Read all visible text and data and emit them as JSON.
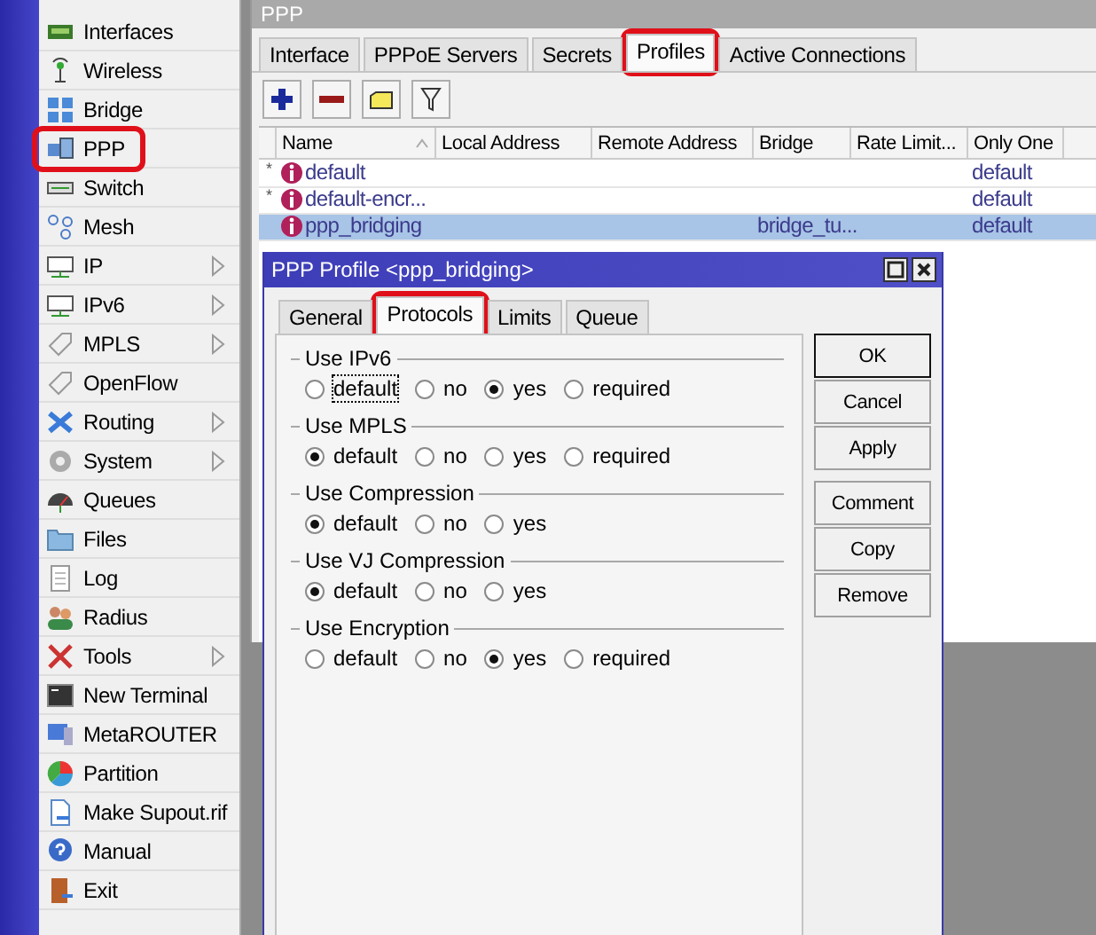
{
  "sidebar": {
    "items": [
      {
        "label": "Interfaces",
        "submenu": false,
        "highlighted": false
      },
      {
        "label": "Wireless",
        "submenu": false,
        "highlighted": false
      },
      {
        "label": "Bridge",
        "submenu": false,
        "highlighted": false
      },
      {
        "label": "PPP",
        "submenu": false,
        "highlighted": true
      },
      {
        "label": "Switch",
        "submenu": false,
        "highlighted": false
      },
      {
        "label": "Mesh",
        "submenu": false,
        "highlighted": false
      },
      {
        "label": "IP",
        "submenu": true,
        "highlighted": false
      },
      {
        "label": "IPv6",
        "submenu": true,
        "highlighted": false
      },
      {
        "label": "MPLS",
        "submenu": true,
        "highlighted": false
      },
      {
        "label": "OpenFlow",
        "submenu": false,
        "highlighted": false
      },
      {
        "label": "Routing",
        "submenu": true,
        "highlighted": false
      },
      {
        "label": "System",
        "submenu": true,
        "highlighted": false
      },
      {
        "label": "Queues",
        "submenu": false,
        "highlighted": false
      },
      {
        "label": "Files",
        "submenu": false,
        "highlighted": false
      },
      {
        "label": "Log",
        "submenu": false,
        "highlighted": false
      },
      {
        "label": "Radius",
        "submenu": false,
        "highlighted": false
      },
      {
        "label": "Tools",
        "submenu": true,
        "highlighted": false
      },
      {
        "label": "New Terminal",
        "submenu": false,
        "highlighted": false
      },
      {
        "label": "MetaROUTER",
        "submenu": false,
        "highlighted": false
      },
      {
        "label": "Partition",
        "submenu": false,
        "highlighted": false
      },
      {
        "label": "Make Supout.rif",
        "submenu": false,
        "highlighted": false
      },
      {
        "label": "Manual",
        "submenu": false,
        "highlighted": false
      },
      {
        "label": "Exit",
        "submenu": false,
        "highlighted": false
      }
    ]
  },
  "window": {
    "title": "PPP",
    "tabs": [
      {
        "label": "Interface",
        "selected": false,
        "highlighted": false
      },
      {
        "label": "PPPoE Servers",
        "selected": false,
        "highlighted": false
      },
      {
        "label": "Secrets",
        "selected": false,
        "highlighted": false
      },
      {
        "label": "Profiles",
        "selected": true,
        "highlighted": true
      },
      {
        "label": "Active Connections",
        "selected": false,
        "highlighted": false
      }
    ],
    "table": {
      "columns": [
        "Name",
        "Local Address",
        "Remote Address",
        "Bridge",
        "Rate Limit...",
        "Only One"
      ],
      "rows": [
        {
          "marker": "*",
          "cells": [
            "default",
            "",
            "",
            "",
            "",
            "default"
          ],
          "selected": false
        },
        {
          "marker": "*",
          "cells": [
            "default-encr...",
            "",
            "",
            "",
            "",
            "default"
          ],
          "selected": false
        },
        {
          "marker": "",
          "cells": [
            "ppp_bridging",
            "",
            "",
            "bridge_tu...",
            "",
            "default"
          ],
          "selected": true
        }
      ]
    }
  },
  "dialog": {
    "title": "PPP Profile <ppp_bridging>",
    "tabs": [
      {
        "label": "General",
        "selected": false,
        "highlighted": false
      },
      {
        "label": "Protocols",
        "selected": true,
        "highlighted": true
      },
      {
        "label": "Limits",
        "selected": false,
        "highlighted": false
      },
      {
        "label": "Queue",
        "selected": false,
        "highlighted": false
      }
    ],
    "groups": [
      {
        "label": "Use IPv6",
        "options": [
          {
            "label": "default",
            "selected": false,
            "focused": true
          },
          {
            "label": "no",
            "selected": false,
            "focused": false
          },
          {
            "label": "yes",
            "selected": true,
            "focused": false
          },
          {
            "label": "required",
            "selected": false,
            "focused": false
          }
        ]
      },
      {
        "label": "Use MPLS",
        "options": [
          {
            "label": "default",
            "selected": true,
            "focused": false
          },
          {
            "label": "no",
            "selected": false,
            "focused": false
          },
          {
            "label": "yes",
            "selected": false,
            "focused": false
          },
          {
            "label": "required",
            "selected": false,
            "focused": false
          }
        ]
      },
      {
        "label": "Use Compression",
        "options": [
          {
            "label": "default",
            "selected": true,
            "focused": false
          },
          {
            "label": "no",
            "selected": false,
            "focused": false
          },
          {
            "label": "yes",
            "selected": false,
            "focused": false
          }
        ]
      },
      {
        "label": "Use VJ Compression",
        "options": [
          {
            "label": "default",
            "selected": true,
            "focused": false
          },
          {
            "label": "no",
            "selected": false,
            "focused": false
          },
          {
            "label": "yes",
            "selected": false,
            "focused": false
          }
        ]
      },
      {
        "label": "Use Encryption",
        "options": [
          {
            "label": "default",
            "selected": false,
            "focused": false
          },
          {
            "label": "no",
            "selected": false,
            "focused": false
          },
          {
            "label": "yes",
            "selected": true,
            "focused": false
          },
          {
            "label": "required",
            "selected": false,
            "focused": false
          }
        ]
      }
    ],
    "button_groups": [
      [
        {
          "label": "OK",
          "default": true
        },
        {
          "label": "Cancel",
          "default": false
        },
        {
          "label": "Apply",
          "default": false
        }
      ],
      [
        {
          "label": "Comment",
          "default": false
        },
        {
          "label": "Copy",
          "default": false
        },
        {
          "label": "Remove",
          "default": false
        }
      ]
    ]
  }
}
